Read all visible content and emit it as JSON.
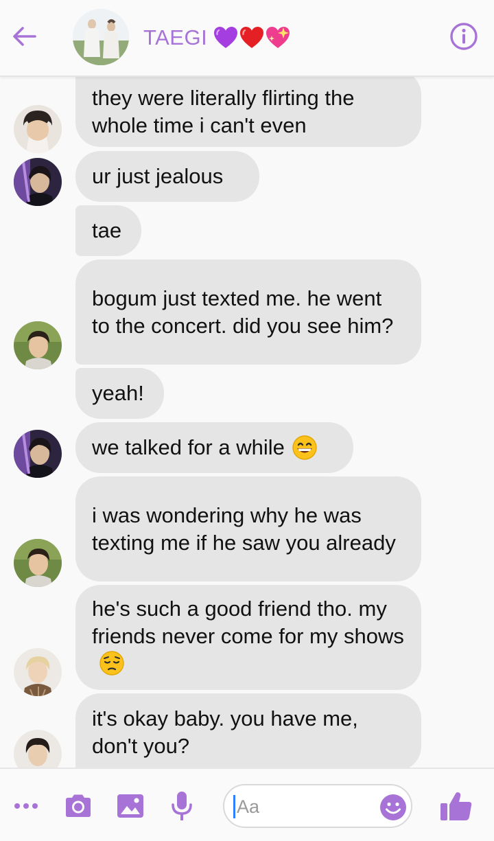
{
  "header": {
    "title": "TAEGI",
    "title_emoji": [
      "purple-heart",
      "red-heart",
      "sparkling-heart"
    ],
    "back_icon": "back-arrow-icon",
    "info_icon": "info-icon"
  },
  "colors": {
    "accent": "#a873d6",
    "bubble": "#e5e5e5",
    "text": "#111111",
    "background": "#f9f9f9"
  },
  "messages": [
    {
      "text": "they were literally flirting the whole time i can't even",
      "avatar": "sender-a"
    },
    {
      "text": "ur just jealous",
      "avatar": "sender-b"
    },
    {
      "text": "tae",
      "avatar": ""
    },
    {
      "text": "bogum just texted me. he went to the concert. did you see him?",
      "avatar": "sender-c"
    },
    {
      "text": "yeah!",
      "avatar": ""
    },
    {
      "text": "we talked for a while",
      "emoji": "grinning-face",
      "avatar": "sender-b"
    },
    {
      "text": "i was wondering why he was texting me if he saw you already",
      "avatar": "sender-c"
    },
    {
      "text": "he's such a good friend tho. my friends never come for my shows",
      "emoji": "pensive-face",
      "avatar": "sender-d"
    },
    {
      "text": "it's okay baby. you have me, don't you?",
      "avatar": "sender-e"
    }
  ],
  "composer": {
    "placeholder": "Aa"
  },
  "toolbar": {
    "icons": [
      "more-icon",
      "camera-icon",
      "image-icon",
      "microphone-icon",
      "emoji-icon",
      "thumbs-up-icon"
    ]
  }
}
